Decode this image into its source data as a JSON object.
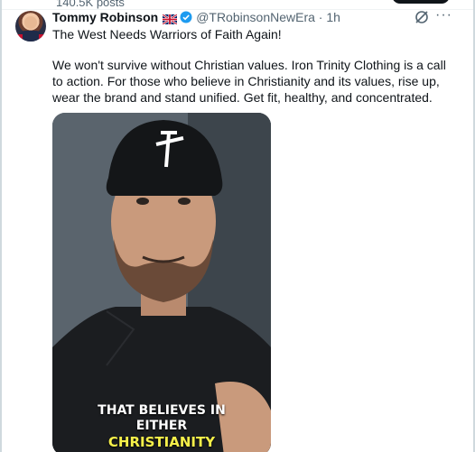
{
  "profile": {
    "posts_count": "140.5K posts"
  },
  "tweet": {
    "author_name": "Tommy Robinson",
    "handle_time": "@TRobinsonNewEra · 1h",
    "headline": "The West Needs Warriors of Faith Again!",
    "body": "We won't survive without Christian values. Iron Trinity Clothing is a call to action. For those who believe in Christianity and its values, rise up, wear the brand and stand unified. Get fit, healthy, and concentrated.",
    "more_label": "···"
  },
  "video": {
    "caption_line1": "THAT BELIEVES IN",
    "caption_line2": "EITHER",
    "caption_line3": "CHRISTIANITY",
    "caption_highlight_color": "#f6f04a"
  },
  "colors": {
    "verified": "#1d9bf0",
    "muted": "#536471"
  }
}
